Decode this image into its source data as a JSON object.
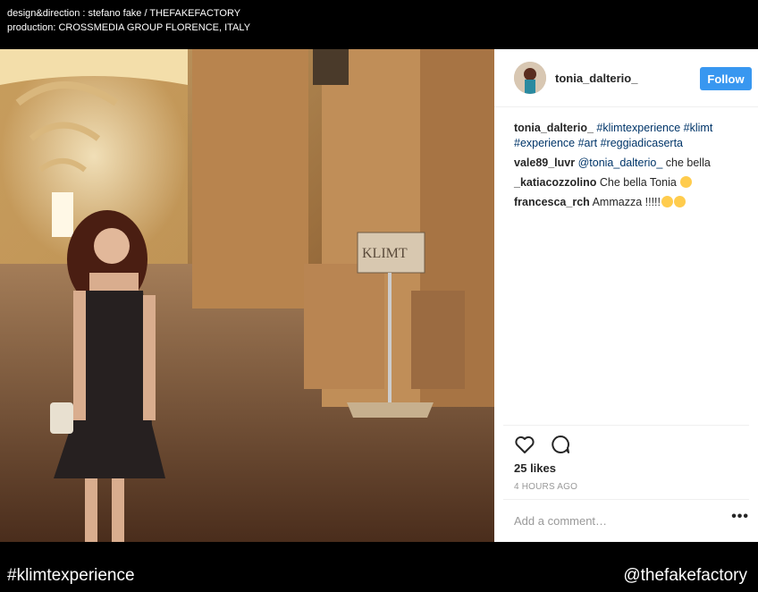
{
  "credits": {
    "line1": "design&direction : stefano fake / THEFAKEFACTORY",
    "line2": "production: CROSSMEDIA GROUP FLORENCE, ITALY"
  },
  "post": {
    "username": "tonia_dalterio_",
    "follow_label": "Follow",
    "sign_text": "KLIMT",
    "caption": {
      "user": "tonia_dalterio_",
      "text": "#klimtexperience #klimt #experience #art #reggiadicaserta"
    },
    "comments": [
      {
        "user": "vale89_luvr",
        "mention": "@tonia_dalterio_",
        "text": " che bella"
      },
      {
        "user": "_katiacozzolino",
        "text": "Che bella Tonia"
      },
      {
        "user": "francesca_rch",
        "text": "Ammazza !!!!!"
      }
    ],
    "likes": "25 likes",
    "time": "4 HOURS AGO",
    "add_comment_placeholder": "Add a comment…",
    "more_label": "•••"
  },
  "icons": {
    "like": "heart-icon",
    "comment": "comment-icon",
    "more": "more-options-icon"
  },
  "colors": {
    "follow": "#3897f0",
    "hashtag": "#003569",
    "background": "#000000"
  },
  "footer": {
    "hashtag": "#klimtexperience",
    "handle": "@thefakefactory"
  }
}
